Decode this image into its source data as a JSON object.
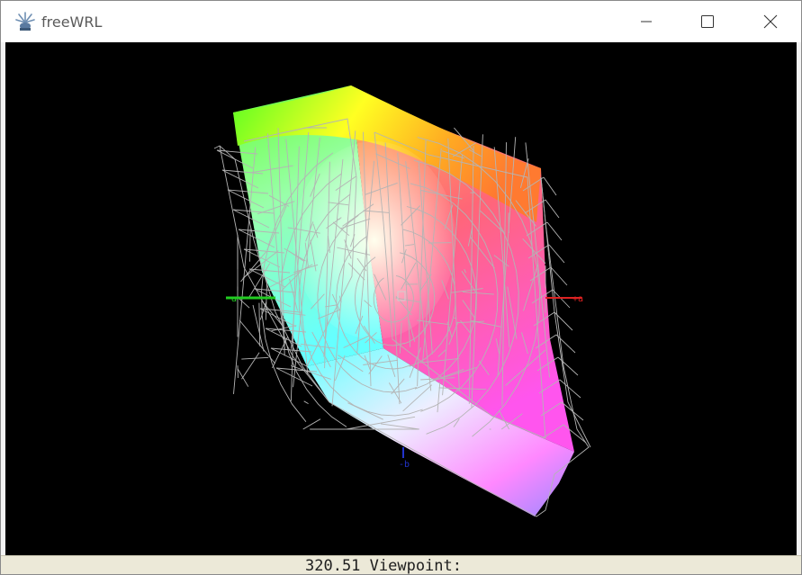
{
  "window": {
    "title": "freeWRL",
    "controls": {
      "minimize": "minimize-icon",
      "maximize": "maximize-icon",
      "close": "close-icon"
    }
  },
  "scene": {
    "axis_labels": {
      "neg_a": "-a",
      "pos_a": "+a",
      "neg_b": "-b"
    },
    "axis_colors": {
      "a_neg": "#22cc22",
      "a_pos": "#dd2222",
      "b_neg": "#2233cc"
    },
    "wireframe_color": "#b4b4b4"
  },
  "status": {
    "text": "320.51 Viewpoint:"
  }
}
